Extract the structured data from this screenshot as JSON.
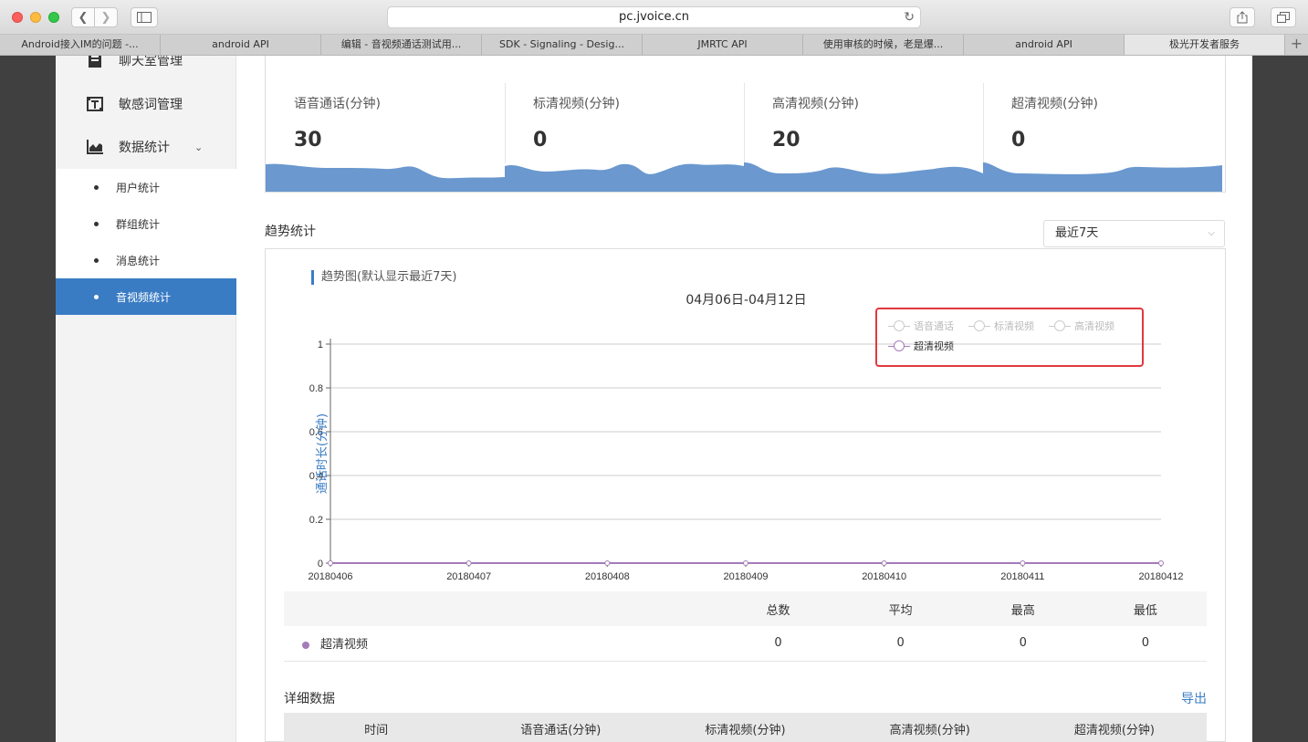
{
  "browser": {
    "url": "pc.jvoice.cn",
    "tabs": [
      {
        "label": "Android接入IM的问题 -..."
      },
      {
        "label": "android API"
      },
      {
        "label": "编辑 - 音视频通话测试用..."
      },
      {
        "label": "SDK - Signaling - Desig..."
      },
      {
        "label": "JMRTC API"
      },
      {
        "label": "使用审核的时候，老是爆..."
      },
      {
        "label": "android API"
      },
      {
        "label": "极光开发者服务"
      }
    ],
    "new_tab": "+"
  },
  "sidebar": {
    "items": [
      {
        "label": "聊天室管理",
        "icon": "chatroom-icon"
      },
      {
        "label": "敏感词管理",
        "icon": "sensitive-words-icon"
      },
      {
        "label": "数据统计",
        "icon": "chart-icon",
        "caret": "⌄"
      }
    ],
    "subitems": [
      {
        "label": "用户统计"
      },
      {
        "label": "群组统计"
      },
      {
        "label": "消息统计"
      },
      {
        "label": "音视频统计"
      }
    ]
  },
  "cards": [
    {
      "label": "语音通话(分钟)",
      "value": "30"
    },
    {
      "label": "标清视频(分钟)",
      "value": "0"
    },
    {
      "label": "高清视频(分钟)",
      "value": "20"
    },
    {
      "label": "超清视频(分钟)",
      "value": "0"
    }
  ],
  "trend": {
    "title": "趋势统计",
    "range": "最近7天",
    "chart_heading": "趋势图(默认显示最近7天)",
    "date_range": "04月06日-04月12日"
  },
  "chart_data": {
    "type": "line",
    "title": "04月06日-04月12日",
    "ylabel": "通话时长(分钟)",
    "xlabel": "",
    "x": [
      "20180406",
      "20180407",
      "20180408",
      "20180409",
      "20180410",
      "20180411",
      "20180412"
    ],
    "y_ticks": [
      "0",
      "0.2",
      "0.4",
      "0.6",
      "0.8",
      "1"
    ],
    "ylim": [
      0,
      1
    ],
    "grid": true,
    "legend_position": "top-right",
    "series": [
      {
        "name": "语音通话",
        "visible": false,
        "values": []
      },
      {
        "name": "标清视频",
        "visible": false,
        "values": []
      },
      {
        "name": "高清视频",
        "visible": false,
        "values": []
      },
      {
        "name": "超清视频",
        "visible": true,
        "color": "#a57bb8",
        "values": [
          0,
          0,
          0,
          0,
          0,
          0,
          0
        ]
      }
    ]
  },
  "summary": {
    "headers": [
      "",
      "总数",
      "平均",
      "最高",
      "最低"
    ],
    "rows": [
      {
        "series": "超清视频",
        "total": "0",
        "avg": "0",
        "max": "0",
        "min": "0"
      }
    ]
  },
  "details": {
    "title": "详细数据",
    "export": "导出",
    "headers": [
      "时间",
      "语音通话(分钟)",
      "标清视频(分钟)",
      "高清视频(分钟)",
      "超清视频(分钟)"
    ]
  },
  "colors": {
    "accent": "#3a7cc4",
    "wave": "#6a98cf",
    "highlight_border": "#e0393e",
    "series_purple": "#a57bb8"
  }
}
